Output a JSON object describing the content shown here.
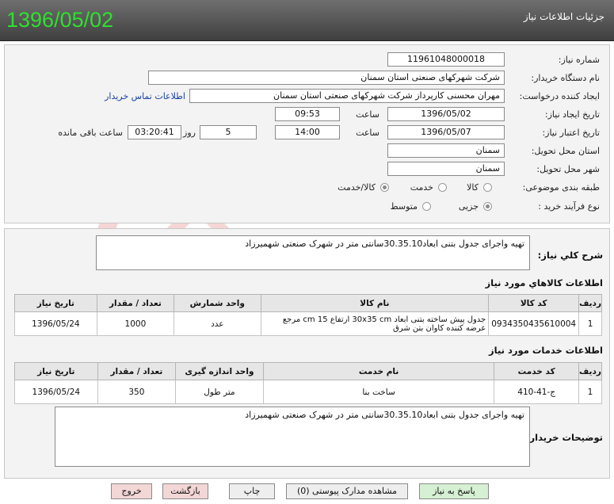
{
  "header": {
    "title": "جزئیات اطلاعات نیاز",
    "date": "1396/05/02"
  },
  "form": {
    "need_number_label": "شماره نیاز:",
    "need_number": "1196104800001‌8",
    "buyer_label": "نام دستگاه خریدار:",
    "buyer": "شرکت شهرکهای صنعتی استان سمنان",
    "creator_label": "ایجاد کننده درخواست:",
    "creator": "مهران محسنی کارپرداز شرکت شهرکهای صنعتی استان سمنان",
    "contact_link": "اطلاعات تماس خریدار",
    "created_label": "تاریخ ایجاد نیاز:",
    "created_date": "1396/05/02",
    "time_label": "ساعت",
    "created_time": "09:53",
    "valid_label": "تاریخ اعتبار نیاز:",
    "valid_date": "1396/05/07",
    "valid_time": "14:00",
    "days": "5",
    "days_label": "روز و",
    "remaining": "03:20:41",
    "remaining_label": "ساعت باقی مانده",
    "province_label": "استان محل تحویل:",
    "province": "سمنان",
    "city_label": "شهر محل تحویل:",
    "city": "سمنان",
    "category_label": "طبقه بندی موضوعی:",
    "category_options": [
      "کالا",
      "خدمت",
      "کالا/خدمت"
    ],
    "category_selected": "کالا/خدمت",
    "process_label": "نوع فرآیند خرید :",
    "process_options": [
      "جزیی",
      "متوسط"
    ],
    "process_selected": "جزیی"
  },
  "summary": {
    "label": "شرح کلي نياز:",
    "text": "تهیه واجرای جدول بتنی ابعاد30.35.10سانتی متر در شهرک صنعتی شهمیرزاد"
  },
  "goods": {
    "title": "اطلاعات کالاهاي مورد نياز",
    "headers": [
      "ردیف",
      "کد کالا",
      "نام کالا",
      "واحد شمارش",
      "تعداد / مقدار",
      "تاریخ نیاز"
    ],
    "rows": [
      {
        "row": "1",
        "code": "0934350435610004",
        "name": "جدول پیش ساخته بتنی ابعاد 30x35 cm ارتفاع 15 cm مرجع عرضه کننده کاوان بتن شرق",
        "unit": "عدد",
        "qty": "1000",
        "date": "1396/05/24"
      }
    ]
  },
  "services": {
    "title": "اطلاعات خدمات مورد نياز",
    "headers": [
      "ردیف",
      "کد خدمت",
      "نام خدمت",
      "واحد اندازه گیری",
      "تعداد / مقدار",
      "تاریخ نیاز"
    ],
    "rows": [
      {
        "row": "1",
        "code": "ج-41-410",
        "name": "ساخت بنا",
        "unit": "متر طول",
        "qty": "350",
        "date": "1396/05/24"
      }
    ]
  },
  "buyer_notes": {
    "label": "توضیحات خریدار:",
    "text": "تهیه واجرای جدول بتنی ابعاد30.35.10سانتی متر در شهرک صنعتی شهمیرزاد"
  },
  "buttons": {
    "reply": "پاسخ به نیاز",
    "attachments": "مشاهده مدارک پیوستی (0)",
    "print": "چاپ",
    "back": "بازگشت",
    "exit": "خروج"
  },
  "colors": {
    "header_date": "#2fe02f",
    "link": "#1a3fa8"
  }
}
